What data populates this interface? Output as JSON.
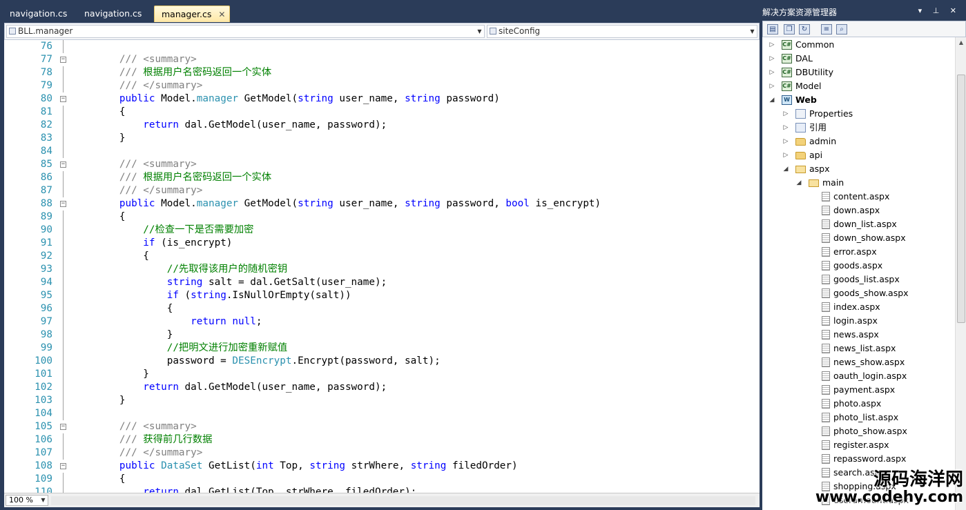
{
  "editor": {
    "tabs": [
      {
        "label": "navigation.cs",
        "active": false
      },
      {
        "label": "navigation.cs",
        "active": false
      },
      {
        "label": "manager.cs",
        "active": true
      }
    ],
    "tab_close_glyph": "✕",
    "nav": {
      "class_combo": "BLL.manager",
      "member_combo": "siteConfig"
    },
    "zoom": "100 %",
    "lines": [
      {
        "n": "76",
        "fold": "",
        "parts": []
      },
      {
        "n": "77",
        "fold": "⊟",
        "parts": [
          [
            "dc",
            "        /// <summary>"
          ]
        ]
      },
      {
        "n": "78",
        "fold": "",
        "parts": [
          [
            "dc",
            "        /// "
          ],
          [
            "cm",
            "根据用户名密码返回一个实体"
          ]
        ]
      },
      {
        "n": "79",
        "fold": "",
        "parts": [
          [
            "dc",
            "        /// </summary>"
          ]
        ]
      },
      {
        "n": "80",
        "fold": "⊟",
        "parts": [
          [
            "kw",
            "        public "
          ],
          [
            "",
            "Model."
          ],
          [
            "ty",
            "manager"
          ],
          [
            "",
            " GetModel("
          ],
          [
            "kw",
            "string"
          ],
          [
            "",
            " user_name, "
          ],
          [
            "kw",
            "string"
          ],
          [
            "",
            " password)"
          ]
        ]
      },
      {
        "n": "81",
        "fold": "",
        "parts": [
          [
            "",
            "        {"
          ]
        ]
      },
      {
        "n": "82",
        "fold": "",
        "parts": [
          [
            "kw",
            "            return"
          ],
          [
            "",
            " dal.GetModel(user_name, password);"
          ]
        ]
      },
      {
        "n": "83",
        "fold": "",
        "parts": [
          [
            "",
            "        }"
          ]
        ]
      },
      {
        "n": "84",
        "fold": "",
        "parts": []
      },
      {
        "n": "85",
        "fold": "⊟",
        "parts": [
          [
            "dc",
            "        /// <summary>"
          ]
        ]
      },
      {
        "n": "86",
        "fold": "",
        "parts": [
          [
            "dc",
            "        /// "
          ],
          [
            "cm",
            "根据用户名密码返回一个实体"
          ]
        ]
      },
      {
        "n": "87",
        "fold": "",
        "parts": [
          [
            "dc",
            "        /// </summary>"
          ]
        ]
      },
      {
        "n": "88",
        "fold": "⊟",
        "parts": [
          [
            "kw",
            "        public "
          ],
          [
            "",
            "Model."
          ],
          [
            "ty",
            "manager"
          ],
          [
            "",
            " GetModel("
          ],
          [
            "kw",
            "string"
          ],
          [
            "",
            " user_name, "
          ],
          [
            "kw",
            "string"
          ],
          [
            "",
            " password, "
          ],
          [
            "kw",
            "bool"
          ],
          [
            "",
            " is_encrypt)"
          ]
        ]
      },
      {
        "n": "89",
        "fold": "",
        "parts": [
          [
            "",
            "        {"
          ]
        ]
      },
      {
        "n": "90",
        "fold": "",
        "parts": [
          [
            "cm",
            "            //检查一下是否需要加密"
          ]
        ]
      },
      {
        "n": "91",
        "fold": "",
        "parts": [
          [
            "kw",
            "            if"
          ],
          [
            "",
            " (is_encrypt)"
          ]
        ]
      },
      {
        "n": "92",
        "fold": "",
        "parts": [
          [
            "",
            "            {"
          ]
        ]
      },
      {
        "n": "93",
        "fold": "",
        "parts": [
          [
            "cm",
            "                //先取得该用户的随机密钥"
          ]
        ]
      },
      {
        "n": "94",
        "fold": "",
        "parts": [
          [
            "kw",
            "                string"
          ],
          [
            "",
            " salt = dal.GetSalt(user_name);"
          ]
        ]
      },
      {
        "n": "95",
        "fold": "",
        "parts": [
          [
            "kw",
            "                if"
          ],
          [
            "",
            " ("
          ],
          [
            "kw",
            "string"
          ],
          [
            "",
            ".IsNullOrEmpty(salt))"
          ]
        ]
      },
      {
        "n": "96",
        "fold": "",
        "parts": [
          [
            "",
            "                {"
          ]
        ]
      },
      {
        "n": "97",
        "fold": "",
        "parts": [
          [
            "kw",
            "                    return null"
          ],
          [
            "",
            ";"
          ]
        ]
      },
      {
        "n": "98",
        "fold": "",
        "parts": [
          [
            "",
            "                }"
          ]
        ]
      },
      {
        "n": "99",
        "fold": "",
        "parts": [
          [
            "cm",
            "                //把明文进行加密重新赋值"
          ]
        ]
      },
      {
        "n": "100",
        "fold": "",
        "parts": [
          [
            "",
            "                password = "
          ],
          [
            "ty",
            "DESEncrypt"
          ],
          [
            "",
            ".Encrypt(password, salt);"
          ]
        ]
      },
      {
        "n": "101",
        "fold": "",
        "parts": [
          [
            "",
            "            }"
          ]
        ]
      },
      {
        "n": "102",
        "fold": "",
        "parts": [
          [
            "kw",
            "            return"
          ],
          [
            "",
            " dal.GetModel(user_name, password);"
          ]
        ]
      },
      {
        "n": "103",
        "fold": "",
        "parts": [
          [
            "",
            "        }"
          ]
        ]
      },
      {
        "n": "104",
        "fold": "",
        "parts": []
      },
      {
        "n": "105",
        "fold": "⊟",
        "parts": [
          [
            "dc",
            "        /// <summary>"
          ]
        ]
      },
      {
        "n": "106",
        "fold": "",
        "parts": [
          [
            "dc",
            "        /// "
          ],
          [
            "cm",
            "获得前几行数据"
          ]
        ]
      },
      {
        "n": "107",
        "fold": "",
        "parts": [
          [
            "dc",
            "        /// </summary>"
          ]
        ]
      },
      {
        "n": "108",
        "fold": "⊟",
        "parts": [
          [
            "kw",
            "        public "
          ],
          [
            "ty",
            "DataSet"
          ],
          [
            "",
            " GetList("
          ],
          [
            "kw",
            "int"
          ],
          [
            "",
            " Top, "
          ],
          [
            "kw",
            "string"
          ],
          [
            "",
            " strWhere, "
          ],
          [
            "kw",
            "string"
          ],
          [
            "",
            " filedOrder)"
          ]
        ]
      },
      {
        "n": "109",
        "fold": "",
        "parts": [
          [
            "",
            "        {"
          ]
        ]
      },
      {
        "n": "110",
        "fold": "",
        "parts": [
          [
            "kw",
            "            return"
          ],
          [
            "",
            " dal.GetList(Top, strWhere, filedOrder);"
          ]
        ]
      }
    ]
  },
  "solution": {
    "title": "解决方案资源管理器",
    "title_buttons": "▾ ⊥ ✕",
    "toolbar_icons": [
      "properties-icon",
      "show-all-files-icon",
      "refresh-icon",
      "view-code-icon",
      "class-diagram-icon"
    ],
    "tree": [
      {
        "label": "Common",
        "icon": "cs-project",
        "expander": "▷",
        "level": 0
      },
      {
        "label": "DAL",
        "icon": "cs-project",
        "expander": "▷",
        "level": 0
      },
      {
        "label": "DBUtility",
        "icon": "cs-project",
        "expander": "▷",
        "level": 0
      },
      {
        "label": "Model",
        "icon": "cs-project",
        "expander": "▷",
        "level": 0
      },
      {
        "label": "Web",
        "icon": "web-project",
        "expander": "◢",
        "level": 0,
        "bold": true
      },
      {
        "label": "Properties",
        "icon": "properties",
        "expander": "▷",
        "level": 1
      },
      {
        "label": "引用",
        "icon": "references",
        "expander": "▷",
        "level": 1
      },
      {
        "label": "admin",
        "icon": "folder",
        "expander": "▷",
        "level": 1
      },
      {
        "label": "api",
        "icon": "folder",
        "expander": "▷",
        "level": 1
      },
      {
        "label": "aspx",
        "icon": "folder-open",
        "expander": "◢",
        "level": 1
      },
      {
        "label": "main",
        "icon": "folder-open",
        "expander": "◢",
        "level": 2
      },
      {
        "label": "content.aspx",
        "icon": "file",
        "expander": "",
        "level": 3
      },
      {
        "label": "down.aspx",
        "icon": "file",
        "expander": "",
        "level": 3
      },
      {
        "label": "down_list.aspx",
        "icon": "file",
        "expander": "",
        "level": 3
      },
      {
        "label": "down_show.aspx",
        "icon": "file",
        "expander": "",
        "level": 3
      },
      {
        "label": "error.aspx",
        "icon": "file",
        "expander": "",
        "level": 3
      },
      {
        "label": "goods.aspx",
        "icon": "file",
        "expander": "",
        "level": 3
      },
      {
        "label": "goods_list.aspx",
        "icon": "file",
        "expander": "",
        "level": 3
      },
      {
        "label": "goods_show.aspx",
        "icon": "file",
        "expander": "",
        "level": 3
      },
      {
        "label": "index.aspx",
        "icon": "file",
        "expander": "",
        "level": 3
      },
      {
        "label": "login.aspx",
        "icon": "file",
        "expander": "",
        "level": 3
      },
      {
        "label": "news.aspx",
        "icon": "file",
        "expander": "",
        "level": 3
      },
      {
        "label": "news_list.aspx",
        "icon": "file",
        "expander": "",
        "level": 3
      },
      {
        "label": "news_show.aspx",
        "icon": "file",
        "expander": "",
        "level": 3
      },
      {
        "label": "oauth_login.aspx",
        "icon": "file",
        "expander": "",
        "level": 3
      },
      {
        "label": "payment.aspx",
        "icon": "file",
        "expander": "",
        "level": 3
      },
      {
        "label": "photo.aspx",
        "icon": "file",
        "expander": "",
        "level": 3
      },
      {
        "label": "photo_list.aspx",
        "icon": "file",
        "expander": "",
        "level": 3
      },
      {
        "label": "photo_show.aspx",
        "icon": "file",
        "expander": "",
        "level": 3
      },
      {
        "label": "register.aspx",
        "icon": "file",
        "expander": "",
        "level": 3
      },
      {
        "label": "repassword.aspx",
        "icon": "file",
        "expander": "",
        "level": 3
      },
      {
        "label": "search.aspx",
        "icon": "file",
        "expander": "",
        "level": 3
      },
      {
        "label": "shopping.aspx",
        "icon": "file",
        "expander": "",
        "level": 3
      },
      {
        "label": "useramount.aspx",
        "icon": "file",
        "expander": "",
        "level": 3
      }
    ]
  },
  "watermark": {
    "line1": "源码海洋网",
    "line2": "www.codehy.com"
  }
}
